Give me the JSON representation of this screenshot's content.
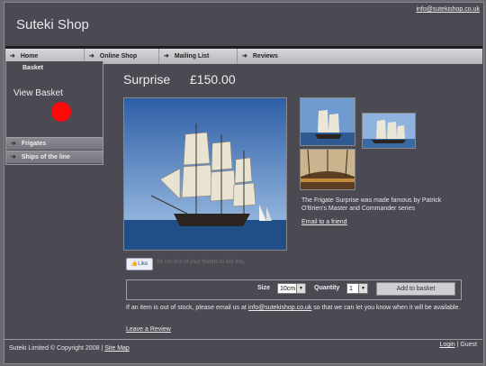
{
  "site": {
    "title": "Suteki Shop",
    "email": "info@sutekishop.co.uk"
  },
  "nav": [
    {
      "label": "Home"
    },
    {
      "label": "Online Shop"
    },
    {
      "label": "Mailing List"
    },
    {
      "label": "Reviews"
    }
  ],
  "left_menu": {
    "basket_label": "Basket",
    "view_basket": "View Basket",
    "categories": [
      {
        "label": "Frigates"
      },
      {
        "label": "Ships of the line"
      }
    ]
  },
  "product": {
    "name": "Surprise",
    "price": "£150.00",
    "description": "The Frigate Surprise was made famous by Patrick O'Brien's Master and Commander series",
    "email_friend": "Email to a friend",
    "thumbnails": [
      "ship-thumbnail",
      "ship-thumbnail",
      "ship-deck-thumbnail"
    ]
  },
  "social": {
    "like_label": "Like",
    "like_text": "Be the first of your friends to like this."
  },
  "purchase": {
    "size_label": "Size",
    "size_value": "10cm",
    "qty_label": "Quantity",
    "qty_value": "1",
    "add_button": "Add to basket"
  },
  "stock_message": {
    "before": "If an item is out of stock, please email us at ",
    "email": "info@sutekishop.co.uk",
    "after": " so that we can let you know when it will be available."
  },
  "review_link": "Leave a Review",
  "footer": {
    "copyright": "Suteki Limited © Copyright 2008 | ",
    "sitemap": "Site Map",
    "login": "Login",
    "guest": " | Guest"
  }
}
